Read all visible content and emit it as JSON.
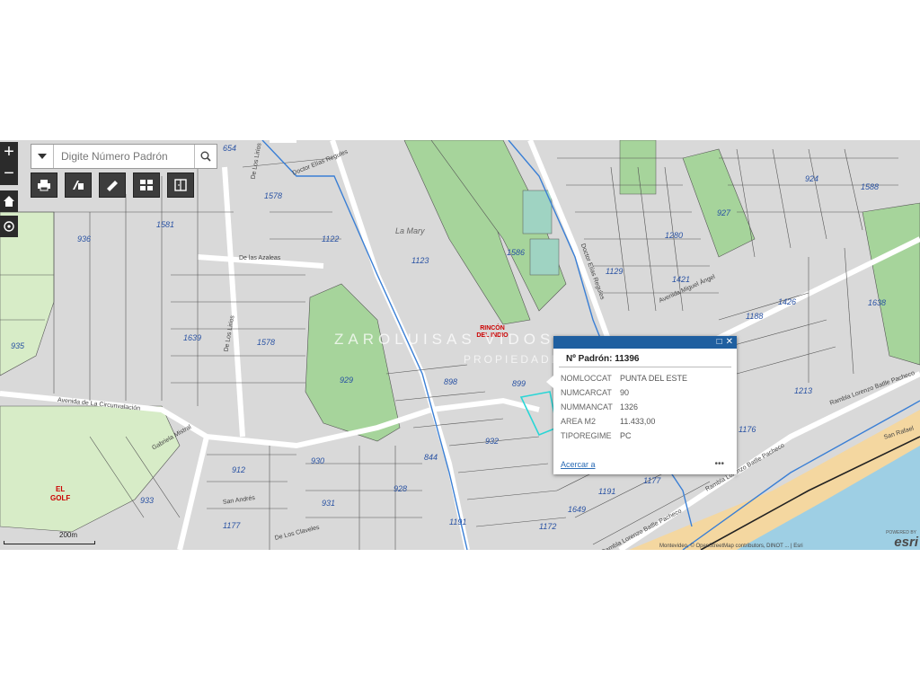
{
  "search": {
    "placeholder": "Digite Número Padrón"
  },
  "tools": [
    {
      "icon": "print-icon"
    },
    {
      "icon": "measure-icon"
    },
    {
      "icon": "ruler-icon"
    },
    {
      "icon": "basemap-gallery-icon"
    },
    {
      "icon": "layer-list-icon"
    }
  ],
  "popup": {
    "title": "Nº Padrón: 11396",
    "fields": [
      {
        "key": "NOMLOCCAT",
        "value": "PUNTA DEL ESTE"
      },
      {
        "key": "NUMCARCAT",
        "value": "90"
      },
      {
        "key": "NUMMANCAT",
        "value": "1326"
      },
      {
        "key": "AREA M2",
        "value": "11.433,00"
      },
      {
        "key": "TIPOREGIME",
        "value": "PC"
      }
    ],
    "zoom_link": "Acercar a",
    "more": "•••",
    "maximize_icon": "□",
    "close_icon": "✕"
  },
  "labels": {
    "parcels": [
      "654",
      "1578",
      "1581",
      "936",
      "935",
      "1122",
      "1123",
      "1639",
      "1578",
      "929",
      "898",
      "899",
      "930",
      "912",
      "933",
      "928",
      "931",
      "1177",
      "844",
      "1586",
      "1129",
      "1421",
      "927",
      "924",
      "1588",
      "1638",
      "1426",
      "1213",
      "1176",
      "1191",
      "1177",
      "1649",
      "1172",
      "1280",
      "1188",
      "932",
      "1191"
    ],
    "places": [
      "La Mary"
    ],
    "golf": [
      "EL",
      "GOLF"
    ],
    "roads": [
      "Doctor Elías Regules",
      "De Los Lirios",
      "De las Azaleas",
      "De Los Lirios",
      "Avenida de La Circunvalación",
      "Avenida Miguel Ángel",
      "Rambla Lorenzo Batlle Pacheco",
      "Rambla Lorenzo Batlle Pacheco",
      "Rambla Lorenzo Batlle Pacheco",
      "San Rafael",
      "Doctor Elías Regules",
      "De Los Claveles",
      "San Andrés",
      "Gabriela Mistral"
    ],
    "watermark_1": "ZAROLUISAS VIDOS",
    "watermark_2": "PROPIEDADES",
    "rincon": "RINCÓN DEL INDIO"
  },
  "scale": {
    "label": "200m"
  },
  "attribution": "Montevideo, © OpenStreetMap contributors, DINOT ... | Esri",
  "esri": {
    "logo": "esri",
    "powered": "POWERED BY"
  },
  "colors": {
    "parcel_fill": "#d9d9d9",
    "park_green": "#a6d49b",
    "ocean": "#9ecfe4",
    "beach": "#f4d7a0",
    "road": "#ffffff",
    "waterway": "#3a7fd5",
    "popup_header": "#1f5fa0"
  }
}
